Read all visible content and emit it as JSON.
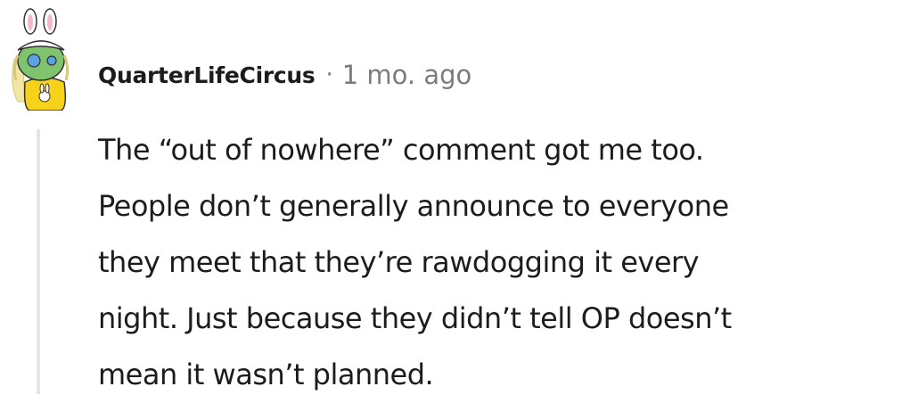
{
  "comment": {
    "author": "QuarterLifeCircus",
    "separator": "·",
    "timestamp": "1 mo. ago",
    "avatar_icon": "snoo-avatar-icon",
    "body_lines": [
      "The “out of nowhere” comment got me too.",
      "People don’t generally announce to everyone",
      "they meet that they’re rawdogging it every",
      "night. Just because they didn’t tell OP doesn’t",
      "mean it wasn’t planned."
    ]
  },
  "colors": {
    "text": "#1c1c1c",
    "meta": "#7c7c7c",
    "thread_line": "#e5e5e5",
    "avatar_skin": "#7fc36f",
    "avatar_hair": "#f1e6a4",
    "avatar_shirt": "#f7d21b"
  }
}
